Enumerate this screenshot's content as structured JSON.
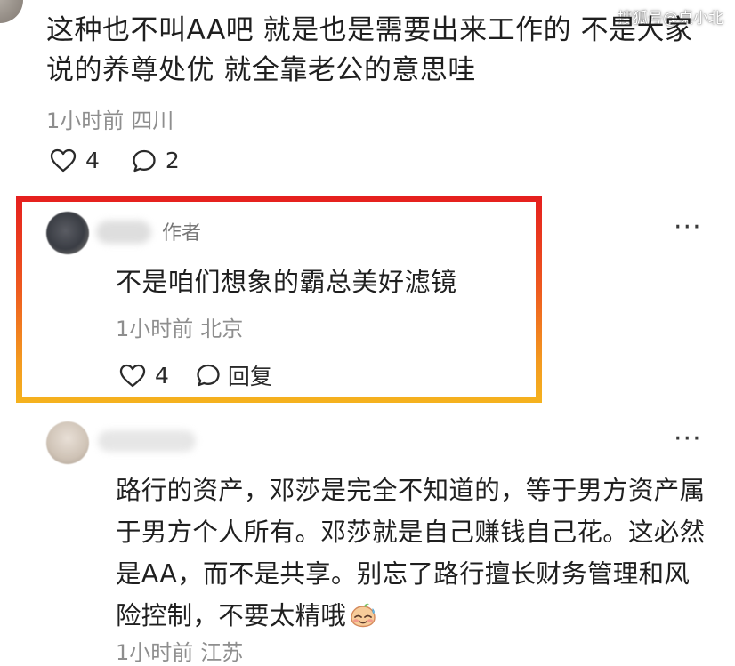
{
  "watermark": "搜狐号@桌小北",
  "comment_top": {
    "text": "这种也不叫AA吧 就是也是需要出来工作的 不是大家说的养尊处优 就全靠老公的意思哇",
    "time": "1小时前",
    "location": "四川",
    "likes": "4",
    "replies": "2"
  },
  "author_reply": {
    "tag": "作者",
    "text": "不是咱们想象的霸总美好滤镜",
    "time": "1小时前",
    "location": "北京",
    "likes": "4",
    "reply_label": "回复",
    "more": "···",
    "highlight_colors": [
      "#e51e1e",
      "#f5b21e"
    ]
  },
  "comment_second": {
    "text": "路行的资产，邓莎是完全不知道的，等于男方资产属于男方个人所有。邓莎就是自己赚钱自己花。这必然是AA，而不是共享。别忘了路行擅长财务管理和风险控制，不要太精哦",
    "emoji": "sweat-smile-emoji",
    "time": "1小时前",
    "location": "江苏",
    "more": "···"
  },
  "icons": {
    "like": "heart-outline-icon",
    "comment": "speech-bubble-icon",
    "more": "more-dots-icon"
  }
}
